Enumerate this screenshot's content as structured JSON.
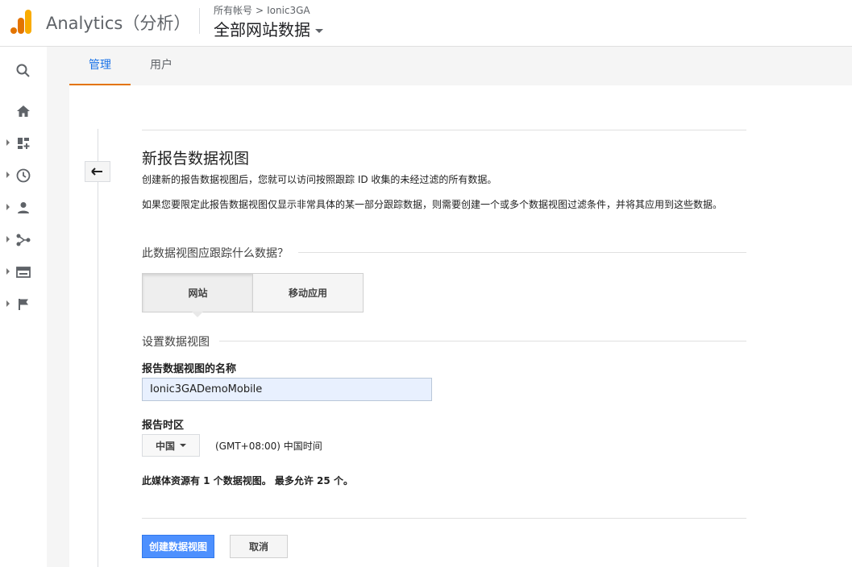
{
  "header": {
    "app_title": "Analytics（分析）",
    "breadcrumb": {
      "root": "所有帐号",
      "separator": ">",
      "account": "Ionic3GA"
    },
    "view_picker_label": "全部网站数据",
    "brand_color": "#f9ab00"
  },
  "sidenav": {
    "items": [
      "search-icon",
      "home-icon",
      "customization-icon",
      "realtime-icon",
      "audience-icon",
      "acquisition-icon",
      "behavior-icon",
      "conversions-icon"
    ]
  },
  "tabs": [
    {
      "label": "管理",
      "active": true
    },
    {
      "label": "用户",
      "active": false
    }
  ],
  "form": {
    "title": "新报告数据视图",
    "desc1": "创建新的报告数据视图后，您就可以访问按照跟踪 ID 收集的未经过滤的所有数据。",
    "desc2": "如果您要限定此报告数据视图仅显示非常具体的某一部分跟踪数据，则需要创建一个或多个数据视图过滤条件，并将其应用到这些数据。",
    "track_section": "此数据视图应跟踪什么数据？",
    "segment": {
      "web": "网站",
      "app": "移动应用",
      "selected": "网站"
    },
    "setup_section": "设置数据视图",
    "name_label": "报告数据视图的名称",
    "name_value": "Ionic3GADemoMobile",
    "tz_label": "报告时区",
    "tz_country": "中国",
    "tz_text": "(GMT+08:00) 中国时间",
    "quota": "此媒体资源有 1 个数据视图。 最多允许 25 个。",
    "create_button": "创建数据视图",
    "cancel_button": "取消"
  },
  "colors": {
    "accent": "#1a73e8",
    "tab_underline": "#e37400",
    "primary_button": "#4d90fe"
  }
}
